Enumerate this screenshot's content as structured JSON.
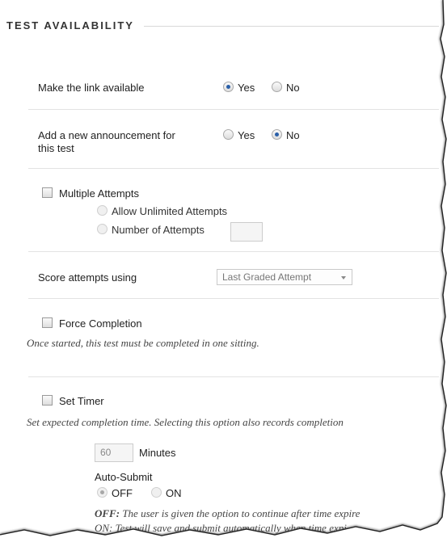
{
  "section": {
    "title": "TEST AVAILABILITY"
  },
  "make_link": {
    "label": "Make the link available",
    "yes": "Yes",
    "no": "No",
    "selected": "Yes"
  },
  "announcement": {
    "label_line1": "Add a new announcement for",
    "label_line2": "this test",
    "yes": "Yes",
    "no": "No",
    "selected": "No"
  },
  "multiple_attempts": {
    "label": "Multiple Attempts",
    "checked": false,
    "allow_unlimited": "Allow Unlimited Attempts",
    "number_of_attempts": "Number of Attempts",
    "number_value": ""
  },
  "score_attempts": {
    "label": "Score attempts using",
    "selected_value": "Last Graded Attempt"
  },
  "force_completion": {
    "label": "Force Completion",
    "checked": false,
    "help": "Once started, this test must be completed in one sitting."
  },
  "set_timer": {
    "label": "Set Timer",
    "checked": false,
    "help": "Set expected completion time. Selecting this option also records completion",
    "minutes_value": "60",
    "minutes_label": "Minutes",
    "auto_submit_label": "Auto-Submit",
    "off": "OFF",
    "on": "ON",
    "selected": "OFF",
    "off_help_bold": "OFF:",
    "off_help": "The user is given the option to continue after time expire",
    "on_help_partial": "ON: Test will save and submit automatically when time expi"
  }
}
